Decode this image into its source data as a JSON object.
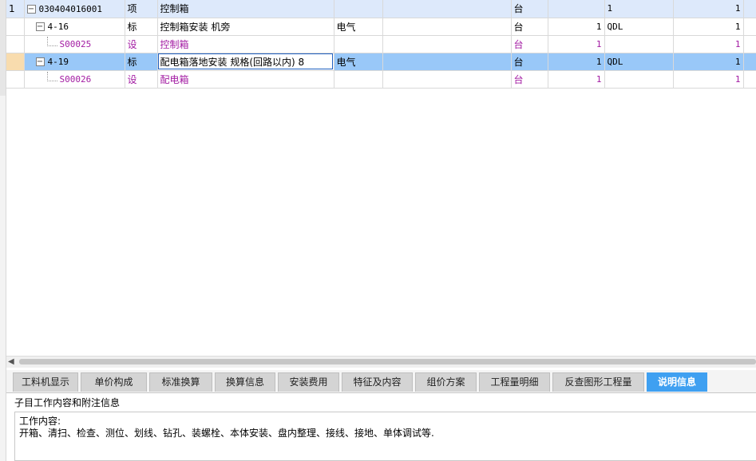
{
  "grid": {
    "rows": [
      {
        "seq": "1",
        "code": "030404016001",
        "type": "项",
        "name": "控制箱",
        "spec": "",
        "unit": "台",
        "qty": "",
        "expr": "1",
        "amount": "1"
      },
      {
        "seq": "",
        "code": "4-16",
        "type": "标",
        "name": "控制箱安装 机旁",
        "spec": "电气",
        "unit": "台",
        "qty": "1",
        "expr": "QDL",
        "amount": "1"
      },
      {
        "seq": "",
        "code": "S00025",
        "type": "设",
        "name": "控制箱",
        "spec": "",
        "unit": "台",
        "qty": "1",
        "expr": "",
        "amount": "1"
      },
      {
        "seq": "",
        "code": "4-19",
        "type": "标",
        "name": "配电箱落地安装 规格(回路以内) 8",
        "spec": "电气",
        "unit": "台",
        "qty": "1",
        "expr": "QDL",
        "amount": "1"
      },
      {
        "seq": "",
        "code": "S00026",
        "type": "设",
        "name": "配电箱",
        "spec": "",
        "unit": "台",
        "qty": "1",
        "expr": "",
        "amount": "1"
      }
    ]
  },
  "icons": {
    "collapse": "minus-box-icon",
    "scroll_left": "scroll-left-arrow-icon"
  },
  "colors": {
    "accent_tab": "#3fa0f1",
    "main_row": "#dde9fb",
    "selected_row": "#99c8f8",
    "equipment_text": "#a31ca3"
  },
  "tabs": [
    {
      "label": "工料机显示",
      "active": false
    },
    {
      "label": "单价构成",
      "active": false
    },
    {
      "label": "标准换算",
      "active": false
    },
    {
      "label": "换算信息",
      "active": false
    },
    {
      "label": "安装费用",
      "active": false
    },
    {
      "label": "特征及内容",
      "active": false
    },
    {
      "label": "组价方案",
      "active": false
    },
    {
      "label": "工程量明细",
      "active": false
    },
    {
      "label": "反查图形工程量",
      "active": false
    },
    {
      "label": "说明信息",
      "active": true
    }
  ],
  "panel": {
    "title": "子目工作内容和附注信息",
    "line1": "工作内容:",
    "line2": "开箱、清扫、检查、测位、划线、钻孔、装螺栓、本体安装、盘内整理、接线、接地、单体调试等."
  }
}
